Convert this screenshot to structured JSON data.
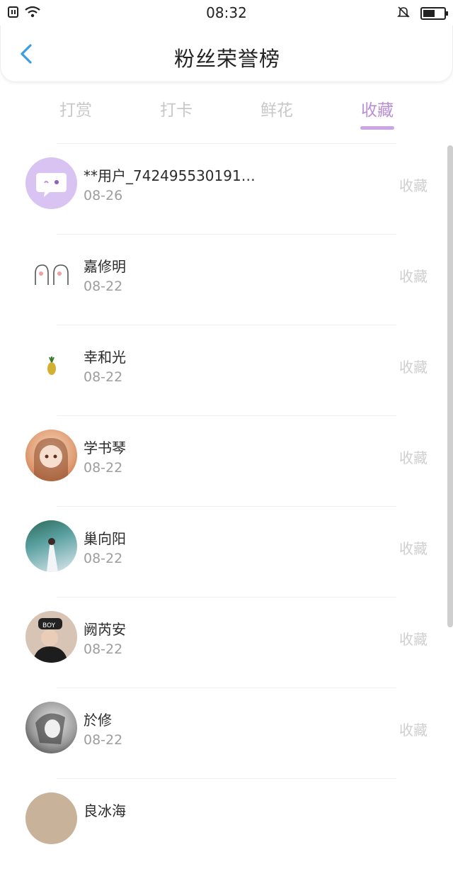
{
  "status": {
    "time": "08:32"
  },
  "header": {
    "title": "粉丝荣誉榜"
  },
  "tabs": [
    {
      "label": "打赏"
    },
    {
      "label": "打卡"
    },
    {
      "label": "鲜花"
    },
    {
      "label": "收藏"
    }
  ],
  "active_tab": "收藏",
  "fans": [
    {
      "name": "**用户_742495530191…",
      "date": "08-26",
      "action": "收藏"
    },
    {
      "name": "嘉修明",
      "date": "08-22",
      "action": "收藏"
    },
    {
      "name": "幸和光",
      "date": "08-22",
      "action": "收藏"
    },
    {
      "name": "学书琴",
      "date": "08-22",
      "action": "收藏"
    },
    {
      "name": "巢向阳",
      "date": "08-22",
      "action": "收藏"
    },
    {
      "name": "阙芮安",
      "date": "08-22",
      "action": "收藏"
    },
    {
      "name": "於修",
      "date": "08-22",
      "action": "收藏"
    },
    {
      "name": "良冰海",
      "date": "",
      "action": ""
    }
  ],
  "colors": {
    "accent": "#b98fd6",
    "tab_inactive": "#c8c8c8",
    "action_text": "#cfcfcf"
  }
}
